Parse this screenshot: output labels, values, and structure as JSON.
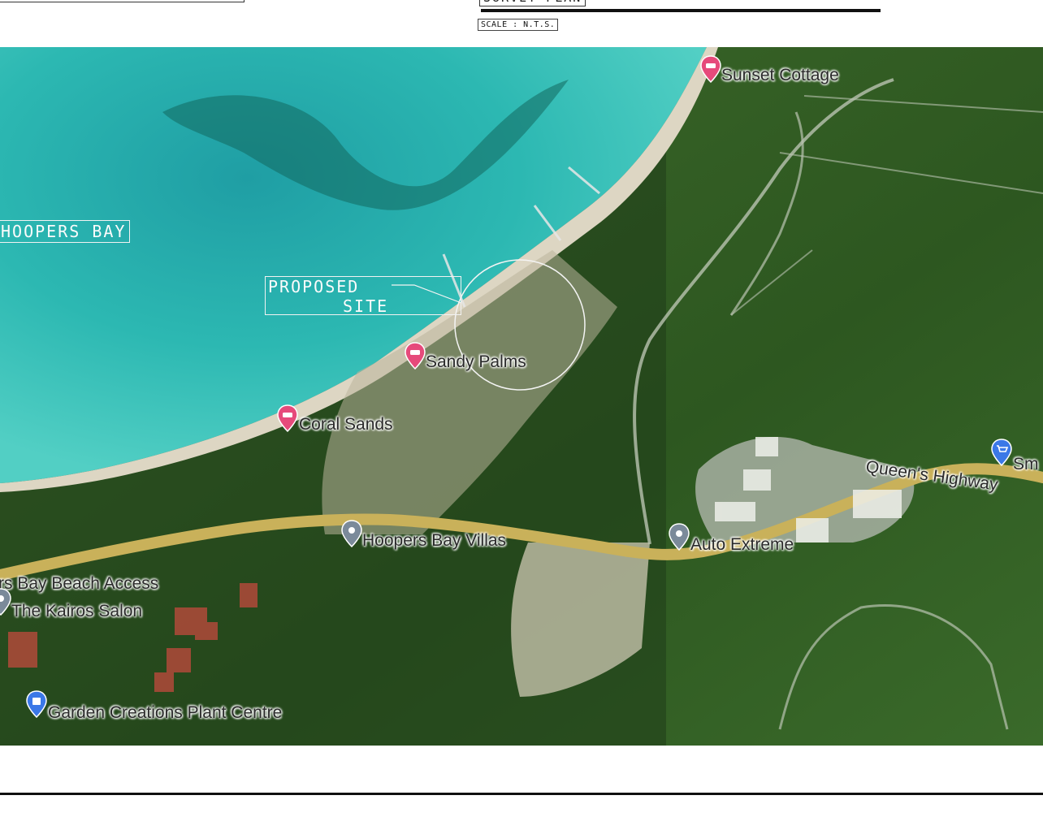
{
  "header": {
    "title_fragment": "SURVEY PLAN",
    "scale_note": "SCALE : N.T.S."
  },
  "map": {
    "water_label": "HOOPERS BAY",
    "site_label_line1": "PROPOSED",
    "site_label_line2": "SITE",
    "places": [
      {
        "label": "Sunset Cottage",
        "icon": "hotel-pin-icon"
      },
      {
        "label": "Sandy Palms",
        "icon": "hotel-pin-icon"
      },
      {
        "label": "Coral Sands",
        "icon": "hotel-pin-icon"
      },
      {
        "label": "Hoopers Bay Villas",
        "icon": "place-pin-icon"
      },
      {
        "label": "Auto Extreme",
        "icon": "place-pin-icon"
      },
      {
        "label": "Queen's Highway",
        "icon": ""
      },
      {
        "label": "Sm",
        "icon": "shopping-pin-icon"
      },
      {
        "label": "rs Bay Beach Access",
        "icon": ""
      },
      {
        "label": "The Kairos Salon",
        "icon": "place-pin-icon"
      },
      {
        "label": "Garden Creations Plant Centre",
        "icon": "shopping-pin-icon"
      }
    ],
    "colors": {
      "water": "#2bb7b0",
      "forest": "#2f5a22",
      "road": "#c9b15a",
      "hotel_pin": "#e64a7b",
      "place_pin": "#7b8a9a",
      "shopping_pin": "#3b78e7"
    }
  }
}
